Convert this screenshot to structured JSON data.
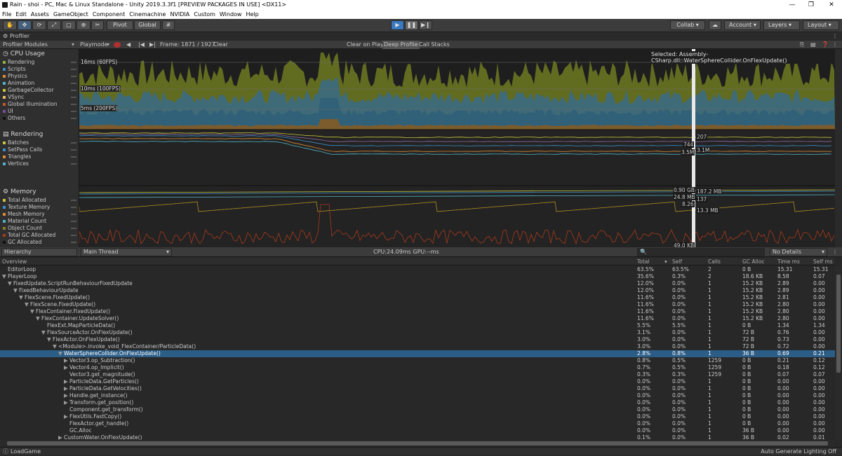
{
  "window": {
    "title": "Rain - shoi - PC, Mac & Linux Standalone - Unity 2019.3.3f1 [PREVIEW PACKAGES IN USE] <DX11>",
    "min": "—",
    "max": "❐",
    "close": "✕"
  },
  "menu": [
    "File",
    "Edit",
    "Assets",
    "GameObject",
    "Component",
    "Cinemachine",
    "NVIDIA",
    "Custom",
    "Window",
    "Help"
  ],
  "toolbar": {
    "pivot": "Pivot",
    "global": "Global",
    "collab": "Collab ▾",
    "account": "Account",
    "layers": "Layers",
    "layout": "Layout"
  },
  "profiler": {
    "tab": "Profiler",
    "modules_label": "Profiler Modules",
    "mode": "Playmode",
    "frame": "Frame: 1871 / 1927",
    "clear": "Clear",
    "clear_on_play": "Clear on Play",
    "deep_profile": "Deep Profile",
    "call_stacks": "Call Stacks",
    "selected": "Selected: Assembly-CSharp.dll::WaterSphereCollider.OnFlexUpdate()"
  },
  "modules": {
    "cpu": {
      "title": "CPU Usage",
      "items": [
        {
          "label": "Rendering",
          "color": "#8fb842"
        },
        {
          "label": "Scripts",
          "color": "#3b8fc4"
        },
        {
          "label": "Physics",
          "color": "#d98b35"
        },
        {
          "label": "Animation",
          "color": "#4fb3c8"
        },
        {
          "label": "GarbageCollector",
          "color": "#c9c43d"
        },
        {
          "label": "VSync",
          "color": "#e0c060"
        },
        {
          "label": "Global Illumination",
          "color": "#c05a2a"
        },
        {
          "label": "UI",
          "color": "#7a4fa0"
        },
        {
          "label": "Others",
          "color": "#101010"
        }
      ]
    },
    "rendering": {
      "title": "Rendering",
      "items": [
        {
          "label": "Batches",
          "color": "#c9c43d"
        },
        {
          "label": "SetPass Calls",
          "color": "#3b8fc4"
        },
        {
          "label": "Triangles",
          "color": "#d98b35"
        },
        {
          "label": "Vertices",
          "color": "#4fb3c8"
        }
      ]
    },
    "memory": {
      "title": "Memory",
      "items": [
        {
          "label": "Total Allocated",
          "color": "#c9c43d"
        },
        {
          "label": "Texture Memory",
          "color": "#3b8fc4"
        },
        {
          "label": "Mesh Memory",
          "color": "#d98b35"
        },
        {
          "label": "Material Count",
          "color": "#4fb3c8"
        },
        {
          "label": "Object Count",
          "color": "#8a7a2a"
        },
        {
          "label": "Total GC Allocated",
          "color": "#a83a1a"
        },
        {
          "label": "GC Allocated",
          "color": "#101010"
        }
      ]
    }
  },
  "chart_labels": {
    "cpu": [
      "16ms (60FPS)",
      "10ms (100FPS)",
      "5ms (200FPS)"
    ],
    "rendering": [
      "207",
      "744",
      "3.5M",
      "3.1M"
    ],
    "memory": [
      "0.90 GB",
      "187.2 MB",
      "24.8 MB",
      "137",
      "8.26",
      "13.3 MB",
      "49.0 KB"
    ]
  },
  "hierarchy": {
    "view": "Hierarchy",
    "thread": "Main Thread",
    "cpu_gpu": "CPU:24.09ms   GPU:--ms",
    "details": "No Details",
    "columns": [
      "Overview",
      "Total",
      "Self",
      "Calls",
      "GC Alloc",
      "Time ms",
      "Self ms"
    ],
    "rows": [
      {
        "depth": 0,
        "exp": "",
        "name": "EditorLoop",
        "v": [
          "63.5%",
          "63.5%",
          "2",
          "0 B",
          "15.31",
          "15.31"
        ]
      },
      {
        "depth": 0,
        "exp": "▼",
        "name": "PlayerLoop",
        "v": [
          "35.6%",
          "0.3%",
          "2",
          "18.6 KB",
          "8.58",
          "0.07"
        ]
      },
      {
        "depth": 1,
        "exp": "▼",
        "name": "FixedUpdate.ScriptRunBehaviourFixedUpdate",
        "v": [
          "12.0%",
          "0.0%",
          "1",
          "15.2 KB",
          "2.89",
          "0.00"
        ]
      },
      {
        "depth": 2,
        "exp": "▼",
        "name": "FixedBehaviourUpdate",
        "v": [
          "12.0%",
          "0.0%",
          "1",
          "15.2 KB",
          "2.89",
          "0.00"
        ]
      },
      {
        "depth": 3,
        "exp": "▼",
        "name": "FlexScene.FixedUpdate()",
        "v": [
          "11.6%",
          "0.0%",
          "1",
          "15.2 KB",
          "2.81",
          "0.00"
        ]
      },
      {
        "depth": 4,
        "exp": "▼",
        "name": "FlexScene.FixedUpdate()",
        "v": [
          "11.6%",
          "0.0%",
          "1",
          "15.2 KB",
          "2.80",
          "0.00"
        ]
      },
      {
        "depth": 5,
        "exp": "▼",
        "name": "FlexContainer.FixedUpdate()",
        "v": [
          "11.6%",
          "0.0%",
          "1",
          "15.2 KB",
          "2.80",
          "0.00"
        ]
      },
      {
        "depth": 6,
        "exp": "▼",
        "name": "FlexContainer.UpdateSolver()",
        "v": [
          "11.6%",
          "0.0%",
          "1",
          "15.2 KB",
          "2.80",
          "0.00"
        ]
      },
      {
        "depth": 7,
        "exp": "",
        "name": "FlexExt.MapParticleData()",
        "v": [
          "5.5%",
          "5.5%",
          "1",
          "0 B",
          "1.34",
          "1.34"
        ]
      },
      {
        "depth": 7,
        "exp": "▼",
        "name": "FlexSourceActor.OnFlexUpdate()",
        "v": [
          "3.1%",
          "0.0%",
          "1",
          "72 B",
          "0.76",
          "0.00"
        ]
      },
      {
        "depth": 8,
        "exp": "▼",
        "name": "FlexActor.OnFlexUpdate()",
        "v": [
          "3.0%",
          "0.0%",
          "1",
          "72 B",
          "0.73",
          "0.00"
        ]
      },
      {
        "depth": 9,
        "exp": "▼",
        "name": "<Module>.invoke_void_FlexContainer/ParticleData()",
        "v": [
          "3.0%",
          "0.0%",
          "1",
          "72 B",
          "0.72",
          "0.00"
        ]
      },
      {
        "depth": 10,
        "exp": "▼",
        "name": "WaterSphereCollider.OnFlexUpdate()",
        "v": [
          "2.8%",
          "0.8%",
          "1",
          "36 B",
          "0.69",
          "0.21"
        ],
        "hl": true
      },
      {
        "depth": 11,
        "exp": "▶",
        "name": "Vector3.op_Subtraction()",
        "v": [
          "0.8%",
          "0.5%",
          "1259",
          "0 B",
          "0.21",
          "0.12"
        ]
      },
      {
        "depth": 11,
        "exp": "▶",
        "name": "Vector4.op_Implicit()",
        "v": [
          "0.7%",
          "0.5%",
          "1259",
          "0 B",
          "0.18",
          "0.12"
        ]
      },
      {
        "depth": 11,
        "exp": "",
        "name": "Vector3.get_magnitude()",
        "v": [
          "0.3%",
          "0.3%",
          "1259",
          "0 B",
          "0.07",
          "0.07"
        ]
      },
      {
        "depth": 11,
        "exp": "▶",
        "name": "ParticleData.GetParticles()",
        "v": [
          "0.0%",
          "0.0%",
          "1",
          "0 B",
          "0.00",
          "0.00"
        ]
      },
      {
        "depth": 11,
        "exp": "▶",
        "name": "ParticleData.GetVelocities()",
        "v": [
          "0.0%",
          "0.0%",
          "1",
          "0 B",
          "0.00",
          "0.00"
        ]
      },
      {
        "depth": 11,
        "exp": "▶",
        "name": "Handle.get_instance()",
        "v": [
          "0.0%",
          "0.0%",
          "1",
          "0 B",
          "0.00",
          "0.00"
        ]
      },
      {
        "depth": 11,
        "exp": "▶",
        "name": "Transform.get_position()",
        "v": [
          "0.0%",
          "0.0%",
          "1",
          "0 B",
          "0.00",
          "0.00"
        ]
      },
      {
        "depth": 11,
        "exp": "",
        "name": "Component.get_transform()",
        "v": [
          "0.0%",
          "0.0%",
          "1",
          "0 B",
          "0.00",
          "0.00"
        ]
      },
      {
        "depth": 11,
        "exp": "▶",
        "name": "FlexUtils.FastCopy()",
        "v": [
          "0.0%",
          "0.0%",
          "1",
          "0 B",
          "0.00",
          "0.00"
        ]
      },
      {
        "depth": 11,
        "exp": "",
        "name": "FlexActor.get_handle()",
        "v": [
          "0.0%",
          "0.0%",
          "1",
          "0 B",
          "0.00",
          "0.00"
        ]
      },
      {
        "depth": 11,
        "exp": "",
        "name": "GC.Alloc",
        "v": [
          "0.0%",
          "0.0%",
          "1",
          "36 B",
          "0.00",
          "0.00"
        ]
      },
      {
        "depth": 10,
        "exp": "▶",
        "name": "CustomWater.OnFlexUpdate()",
        "v": [
          "0.1%",
          "0.0%",
          "1",
          "36 B",
          "0.02",
          "0.01"
        ]
      }
    ]
  },
  "status": {
    "left": "LoadGame",
    "right": "Auto Generate Lighting Off"
  }
}
